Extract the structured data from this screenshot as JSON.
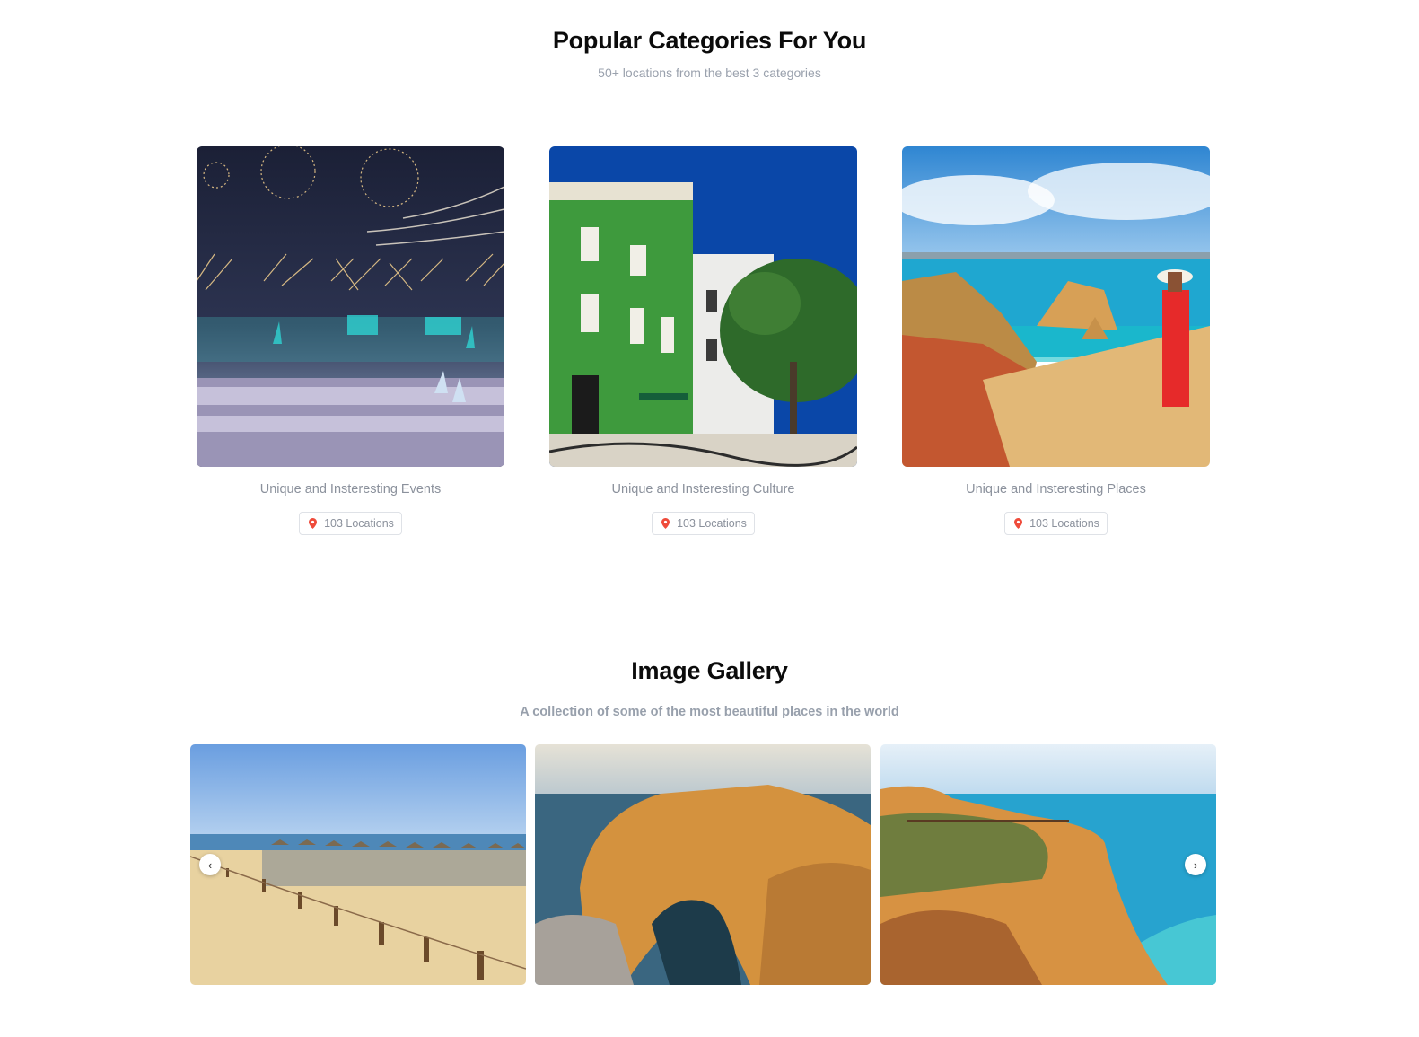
{
  "categories_section": {
    "title": "Popular Categories For You",
    "subtitle": "50+ locations from the best 3 categories",
    "cards": [
      {
        "title": "Unique and Insteresting Events",
        "badge": "103 Locations",
        "image": "fireworks-show-image"
      },
      {
        "title": "Unique and Insteresting Culture",
        "badge": "103 Locations",
        "image": "green-tiled-building-image"
      },
      {
        "title": "Unique and Insteresting Places",
        "badge": "103 Locations",
        "image": "coastal-cliffs-image"
      }
    ]
  },
  "gallery_section": {
    "title": "Image Gallery",
    "subtitle": "A collection of some of the most beautiful places in the world",
    "images": [
      "beach-umbrellas-image",
      "rock-arch-image",
      "cliff-coastline-image"
    ],
    "prev_icon": "chevron-left-icon",
    "next_icon": "chevron-right-icon"
  },
  "colors": {
    "pin": "#ef4b3b",
    "muted_text": "#8b919c",
    "badge_border": "#dfe2e7"
  }
}
